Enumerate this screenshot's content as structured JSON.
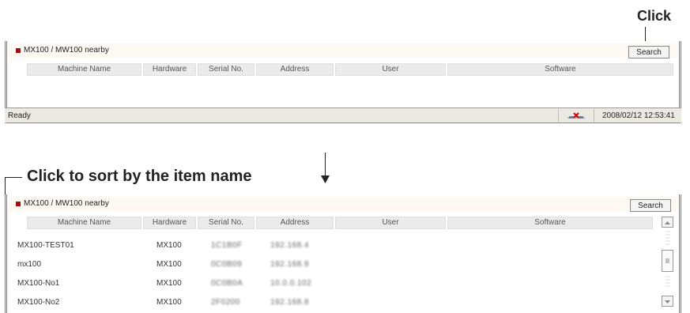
{
  "annotations": {
    "click": "Click",
    "sort": "Click to sort by the item name"
  },
  "panel": {
    "nearby_label": "MX100 / MW100 nearby",
    "search_label": "Search",
    "columns": [
      "Machine Name",
      "Hardware",
      "Serial No.",
      "Address",
      "User",
      "Software"
    ]
  },
  "status": {
    "ready": "Ready",
    "datetime": "2008/02/12 12:53:41"
  },
  "rows": [
    {
      "name": "MX100-TEST01",
      "hardware": "MX100",
      "serial": "1C1B0F",
      "address": "192.168.4"
    },
    {
      "name": "mx100",
      "hardware": "MX100",
      "serial": "0C0B09",
      "address": "192.168.9"
    },
    {
      "name": "MX100-No1",
      "hardware": "MX100",
      "serial": "0C0B0A",
      "address": "10.0.0.102"
    },
    {
      "name": "MX100-No2",
      "hardware": "MX100",
      "serial": "2F0200",
      "address": "192.168.8"
    }
  ],
  "colors": {
    "nearby_marker": "#a01010",
    "header_bg": "#ebebeb",
    "nearby_bg": "#fdf8f2"
  },
  "icons": {
    "network_status": "network-disconnected-icon",
    "scroll_up": "arrow-up-icon",
    "scroll_down": "arrow-down-icon",
    "scroll_thumb": "grip-icon",
    "down_arrow": "down-arrow-icon"
  }
}
